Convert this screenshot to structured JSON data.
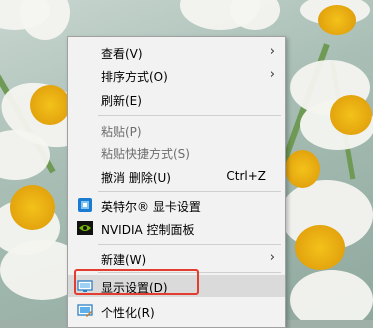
{
  "context_menu": {
    "items": [
      {
        "label": "查看(V)",
        "submenu": true
      },
      {
        "label": "排序方式(O)",
        "submenu": true
      },
      {
        "label": "刷新(E)"
      },
      {
        "label": "粘贴(P)",
        "disabled": true
      },
      {
        "label": "粘贴快捷方式(S)",
        "disabled": true
      },
      {
        "label": "撤消 删除(U)",
        "shortcut": "Ctrl+Z"
      },
      {
        "label": "英特尔® 显卡设置",
        "icon": "intel-graphics-icon"
      },
      {
        "label": "NVIDIA 控制面板",
        "icon": "nvidia-icon"
      },
      {
        "label": "新建(W)",
        "submenu": true
      },
      {
        "label": "显示设置(D)",
        "icon": "display-settings-icon",
        "highlighted": true
      },
      {
        "label": "个性化(R)",
        "icon": "personalize-icon"
      }
    ]
  },
  "colors": {
    "highlight_box": "#e43c2f",
    "menu_background": "#f2f2f2"
  }
}
